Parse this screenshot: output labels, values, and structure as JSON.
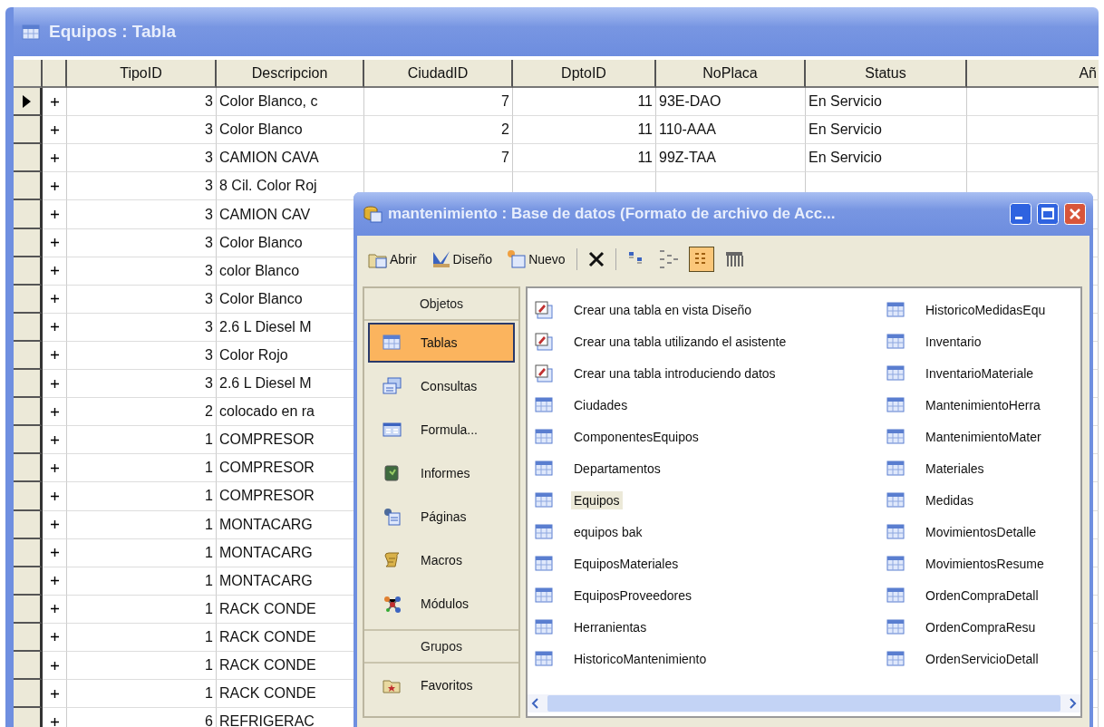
{
  "table_window": {
    "title": "Equipos : Tabla",
    "columns": [
      "TipoID",
      "Descripcion",
      "CiudadID",
      "DptoID",
      "NoPlaca",
      "Status",
      "Añ"
    ],
    "rows": [
      {
        "current": true,
        "cells": [
          "3",
          "Color Blanco, c",
          "7",
          "11",
          "93E-DAO",
          "En Servicio"
        ]
      },
      {
        "current": false,
        "cells": [
          "3",
          "Color Blanco",
          "2",
          "11",
          "110-AAA",
          "En Servicio"
        ]
      },
      {
        "current": false,
        "cells": [
          "3",
          "CAMION CAVA",
          "7",
          "11",
          "99Z-TAA",
          "En Servicio"
        ]
      },
      {
        "current": false,
        "cells": [
          "3",
          "8 Cil. Color Roj"
        ]
      },
      {
        "current": false,
        "cells": [
          "3",
          "CAMION CAV"
        ]
      },
      {
        "current": false,
        "cells": [
          "3",
          "Color Blanco"
        ]
      },
      {
        "current": false,
        "cells": [
          "3",
          "color Blanco"
        ]
      },
      {
        "current": false,
        "cells": [
          "3",
          "Color Blanco"
        ]
      },
      {
        "current": false,
        "cells": [
          "3",
          "2.6 L Diesel M"
        ]
      },
      {
        "current": false,
        "cells": [
          "3",
          "Color Rojo"
        ]
      },
      {
        "current": false,
        "cells": [
          "3",
          "2.6 L Diesel M"
        ]
      },
      {
        "current": false,
        "cells": [
          "2",
          "colocado en ra"
        ]
      },
      {
        "current": false,
        "cells": [
          "1",
          "COMPRESOR"
        ]
      },
      {
        "current": false,
        "cells": [
          "1",
          "COMPRESOR"
        ]
      },
      {
        "current": false,
        "cells": [
          "1",
          "COMPRESOR"
        ]
      },
      {
        "current": false,
        "cells": [
          "1",
          "MONTACARG"
        ]
      },
      {
        "current": false,
        "cells": [
          "1",
          "MONTACARG"
        ]
      },
      {
        "current": false,
        "cells": [
          "1",
          "MONTACARG"
        ]
      },
      {
        "current": false,
        "cells": [
          "1",
          "RACK CONDE"
        ]
      },
      {
        "current": false,
        "cells": [
          "1",
          "RACK CONDE"
        ]
      },
      {
        "current": false,
        "cells": [
          "1",
          "RACK CONDE"
        ]
      },
      {
        "current": false,
        "cells": [
          "1",
          "RACK CONDE"
        ]
      },
      {
        "current": false,
        "cells": [
          "6",
          "REFRIGERAC"
        ]
      }
    ]
  },
  "db_window": {
    "title": "mantenimiento : Base de datos (Formato de archivo de Acc...",
    "toolbar": [
      {
        "kind": "open",
        "label": "Abrir"
      },
      {
        "kind": "design",
        "label": "Diseño"
      },
      {
        "kind": "new",
        "label": "Nuevo"
      },
      {
        "kind": "separator"
      },
      {
        "kind": "delete"
      },
      {
        "kind": "separator"
      },
      {
        "kind": "large-icons",
        "selected": false
      },
      {
        "kind": "small-icons",
        "selected": false
      },
      {
        "kind": "list",
        "selected": true
      },
      {
        "kind": "details",
        "selected": false
      }
    ],
    "sidebar": {
      "header": "Objetos",
      "items": [
        {
          "kind": "table",
          "label": "Tablas",
          "selected": true
        },
        {
          "kind": "query",
          "label": "Consultas",
          "selected": false
        },
        {
          "kind": "form",
          "label": "Formula...",
          "selected": false
        },
        {
          "kind": "report",
          "label": "Informes",
          "selected": false
        },
        {
          "kind": "page",
          "label": "Páginas",
          "selected": false
        },
        {
          "kind": "macro",
          "label": "Macros",
          "selected": false
        },
        {
          "kind": "module",
          "label": "Módulos",
          "selected": false
        }
      ],
      "groups_header": "Grupos",
      "groups": [
        {
          "kind": "favorites",
          "label": "Favoritos",
          "selected": false
        }
      ]
    },
    "objects": [
      {
        "kind": "create",
        "label": "Crear una tabla en vista Diseño",
        "selected": false
      },
      {
        "kind": "create",
        "label": "Crear una tabla utilizando el asistente",
        "selected": false
      },
      {
        "kind": "create",
        "label": "Crear una tabla introduciendo datos",
        "selected": false
      },
      {
        "kind": "table",
        "label": "Ciudades",
        "selected": false
      },
      {
        "kind": "table",
        "label": "ComponentesEquipos",
        "selected": false
      },
      {
        "kind": "table",
        "label": "Departamentos",
        "selected": false
      },
      {
        "kind": "table",
        "label": "Equipos",
        "selected": true
      },
      {
        "kind": "table",
        "label": "equipos bak",
        "selected": false
      },
      {
        "kind": "table",
        "label": "EquiposMateriales",
        "selected": false
      },
      {
        "kind": "table",
        "label": "EquiposProveedores",
        "selected": false
      },
      {
        "kind": "table",
        "label": "Herranientas",
        "selected": false
      },
      {
        "kind": "table",
        "label": "HistoricoMantenimiento",
        "selected": false
      },
      {
        "kind": "table",
        "label": "HistoricoMedidasEqu",
        "selected": false
      },
      {
        "kind": "table",
        "label": "Inventario",
        "selected": false
      },
      {
        "kind": "table",
        "label": "InventarioMateriale",
        "selected": false
      },
      {
        "kind": "table",
        "label": "MantenimientoHerra",
        "selected": false
      },
      {
        "kind": "table",
        "label": "MantenimientoMater",
        "selected": false
      },
      {
        "kind": "table",
        "label": "Materiales",
        "selected": false
      },
      {
        "kind": "table",
        "label": "Medidas",
        "selected": false
      },
      {
        "kind": "table",
        "label": "MovimientosDetalle",
        "selected": false
      },
      {
        "kind": "table",
        "label": "MovimientosResume",
        "selected": false
      },
      {
        "kind": "table",
        "label": "OrdenCompraDetall",
        "selected": false
      },
      {
        "kind": "table",
        "label": "OrdenCompraResu",
        "selected": false
      },
      {
        "kind": "table",
        "label": "OrdenServicioDetall",
        "selected": false
      }
    ]
  }
}
